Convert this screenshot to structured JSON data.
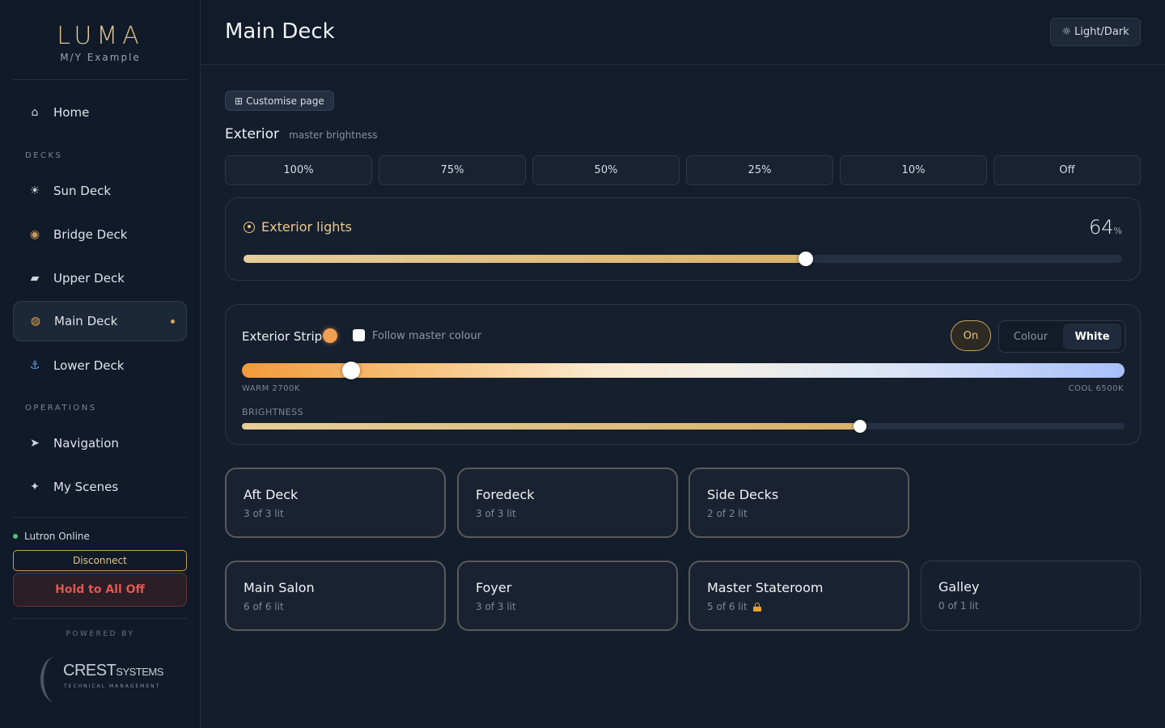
{
  "brand": {
    "logo": "LUMA",
    "vessel": "M/Y Example"
  },
  "sidebar": {
    "home": {
      "label": "Home",
      "icon": "home-icon"
    },
    "decks_label": "DECKS",
    "decks": [
      {
        "label": "Sun Deck",
        "icon": "sun-icon"
      },
      {
        "label": "Bridge Deck",
        "icon": "compass-icon"
      },
      {
        "label": "Upper Deck",
        "icon": "yacht-icon"
      },
      {
        "label": "Main Deck",
        "icon": "dining-icon",
        "active": true
      },
      {
        "label": "Lower Deck",
        "icon": "anchor-icon"
      }
    ],
    "operations_label": "OPERATIONS",
    "operations": [
      {
        "label": "Navigation",
        "icon": "navigation-arrow-icon"
      },
      {
        "label": "My Scenes",
        "icon": "sparkle-icon"
      }
    ],
    "status": "Lutron Online",
    "disconnect_label": "Disconnect",
    "all_off_label": "Hold to All Off",
    "powered_by": "POWERED BY",
    "partner": {
      "name": "CREST",
      "name_suffix": "SYSTEMS",
      "tagline": "TECHNICAL MANAGEMENT"
    }
  },
  "header": {
    "title": "Main Deck",
    "theme_toggle": "Light/Dark"
  },
  "main": {
    "customise_label": "Customise page",
    "section": {
      "title": "Exterior",
      "subtitle": "master brightness"
    },
    "presets": [
      "100%",
      "75%",
      "50%",
      "25%",
      "10%",
      "Off"
    ],
    "exterior_lights": {
      "title": "Exterior lights",
      "value": "64",
      "unit": "%",
      "level": 0.64
    },
    "strip": {
      "title": "Exterior Strip",
      "follow_label": "Follow master colour",
      "follow_checked": false,
      "on_label": "On",
      "mode_options": [
        "Colour",
        "White"
      ],
      "mode_selected": "White",
      "warm_label": "WARM 2700K",
      "cool_label": "COOL 6500K",
      "temperature_level": 0.124,
      "brightness_label": "BRIGHTNESS",
      "brightness_level": 0.7,
      "swatch_color": "#f0a04e"
    },
    "rooms": [
      {
        "name": "Aft Deck",
        "status": "3 of 3 lit"
      },
      {
        "name": "Foredeck",
        "status": "3 of 3 lit"
      },
      {
        "name": "Side Decks",
        "status": "2 of 2 lit"
      },
      {
        "name": "Main Salon",
        "status": "6 of 6 lit"
      },
      {
        "name": "Foyer",
        "status": "3 of 3 lit"
      },
      {
        "name": "Master Stateroom",
        "status": "5 of 6 lit",
        "locked": true
      },
      {
        "name": "Galley",
        "status": "0 of 1 lit"
      }
    ]
  },
  "colors": {
    "accent_gold": "#d9b26b",
    "status_online": "#4ec27a",
    "danger": "#e0574f"
  }
}
